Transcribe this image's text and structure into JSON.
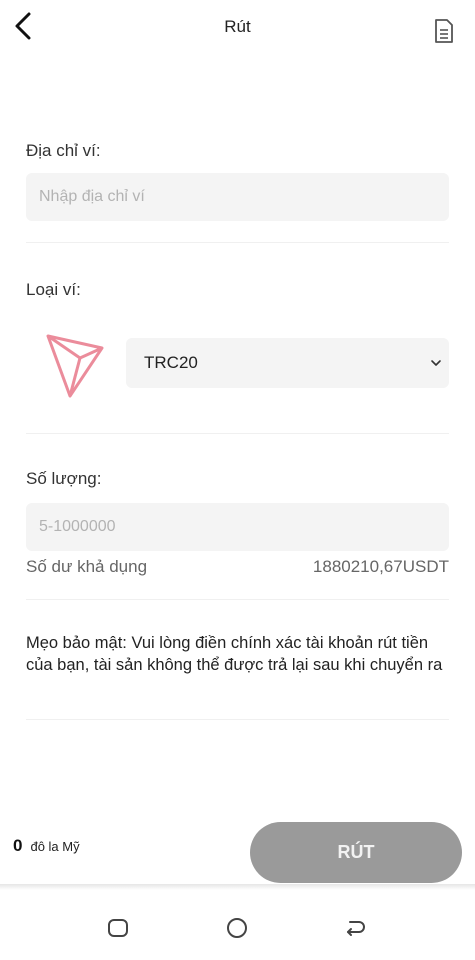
{
  "header": {
    "title": "Rút",
    "back_icon": "back-arrow-icon",
    "records_icon": "document-icon"
  },
  "wallet_address": {
    "label": "Địa chỉ ví:",
    "placeholder": "Nhập địa chỉ ví",
    "value": ""
  },
  "wallet_type": {
    "label": "Loại ví:",
    "logo_icon": "tron-logo-icon",
    "selected": "TRC20",
    "accent_color": "#e8788a"
  },
  "quantity": {
    "label": "Số lượng:",
    "placeholder": "5-1000000",
    "value": "",
    "balance_label": "Số dư khả dụng",
    "balance_value": "1880210,67USDT"
  },
  "security_tip": "Mẹo bảo mật: Vui lòng điền chính xác tài khoản rút tiền của bạn, tài sản không thể được trả lại sau khi chuyển ra",
  "footer": {
    "amount": "0",
    "unit": "đô la Mỹ",
    "withdraw_label": "RÚT",
    "button_color": "#9a9a9a"
  },
  "system_nav": {
    "items": [
      "recent-apps-icon",
      "home-icon",
      "back-icon"
    ]
  }
}
